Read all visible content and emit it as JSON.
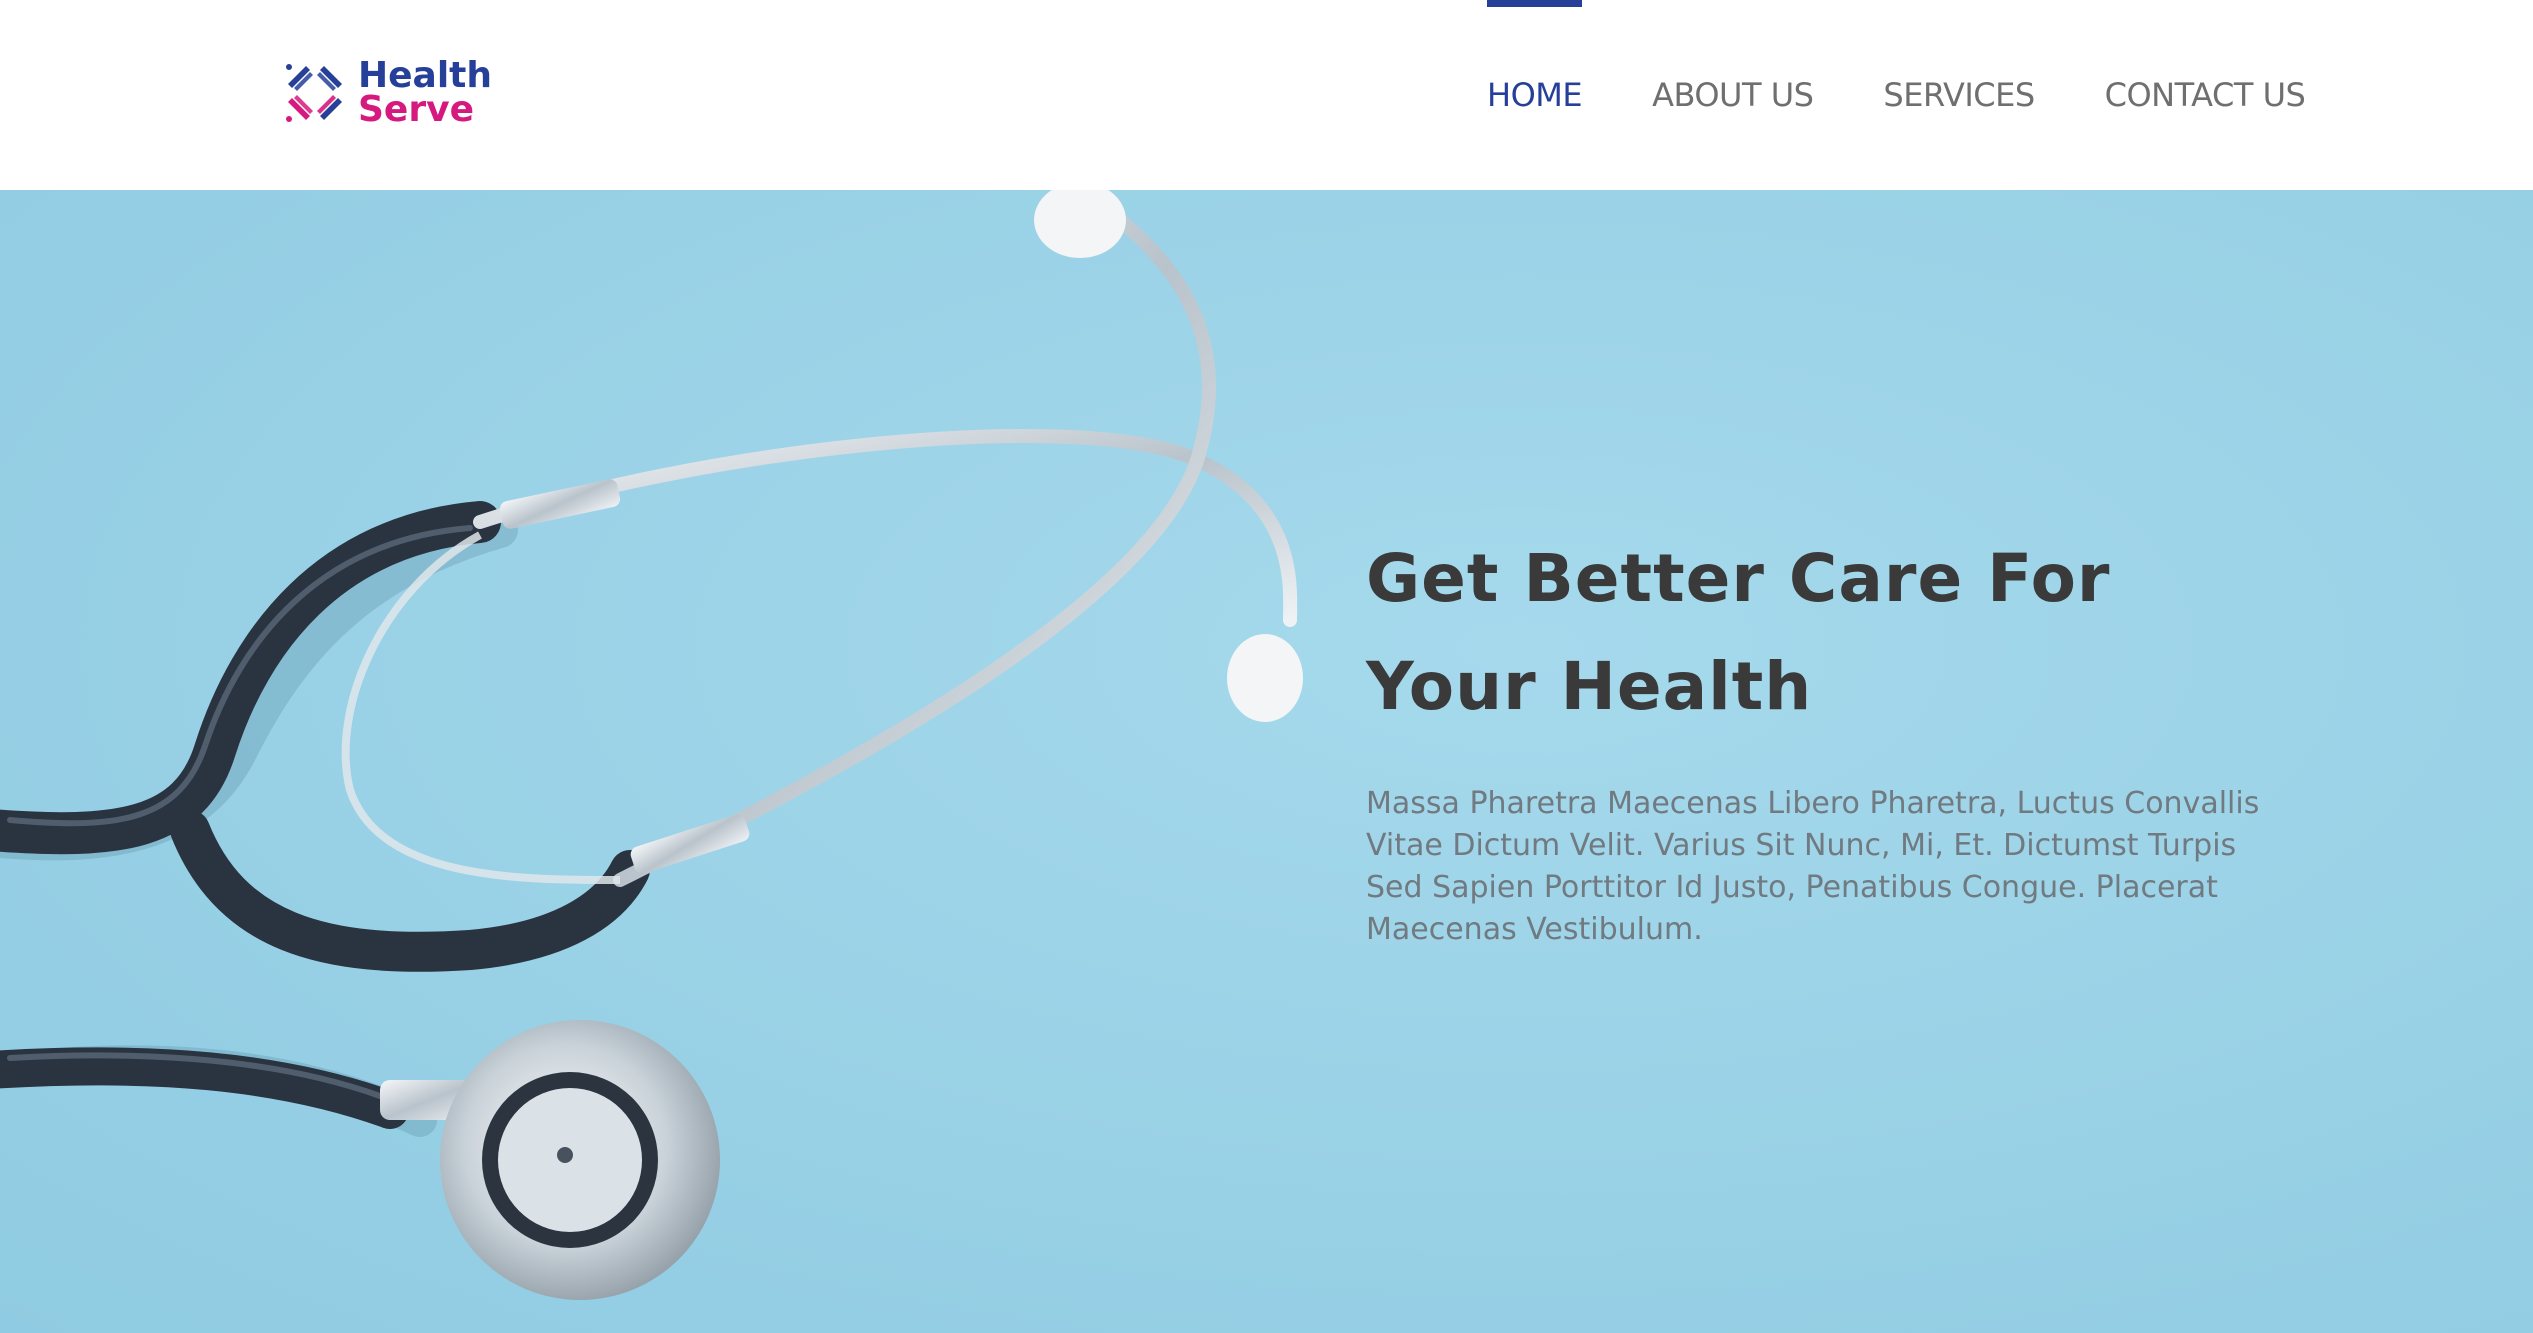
{
  "brand": {
    "name_line1": "Health",
    "name_line2": "Serve",
    "colors": {
      "primary": "#26409a",
      "accent": "#d6197f"
    },
    "icon": "cross-arrows-logo-icon"
  },
  "nav": {
    "items": [
      {
        "label": "HOME",
        "active": true
      },
      {
        "label": "ABOUT US",
        "active": false
      },
      {
        "label": "SERVICES",
        "active": false
      },
      {
        "label": "CONTACT US",
        "active": false
      }
    ]
  },
  "hero": {
    "title_line1": "Get Better Care For",
    "title_line2": "Your Health",
    "description": "Massa Pharetra Maecenas Libero Pharetra, Luctus Convallis Vitae Dictum Velit. Varius Sit Nunc, Mi, Et. Dictumst Turpis Sed Sapien Porttitor Id Justo, Penatibus Congue. Placerat Maecenas Vestibulum.",
    "image": "stethoscope-image",
    "background_color": "#99d1e6"
  }
}
